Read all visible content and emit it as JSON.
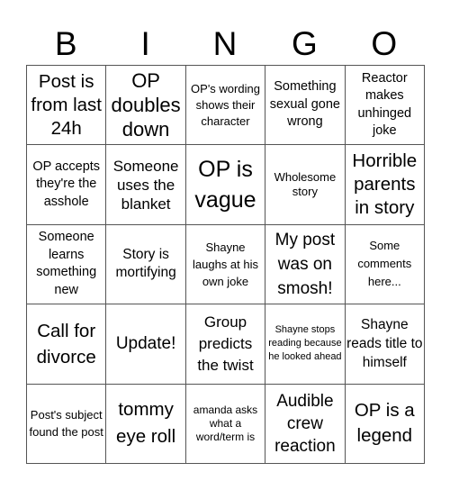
{
  "title_letters": [
    "B",
    "I",
    "N",
    "G",
    "O"
  ],
  "cells": [
    "Post is from last 24h",
    "OP doubles down",
    "OP's wording shows their character",
    "Something sexual gone wrong",
    "Reactor makes unhinged joke",
    "OP accepts they're the asshole",
    "Someone uses the blanket",
    "OP is vague",
    "Wholesome story",
    "Horrible parents in story",
    "Someone learns something new",
    "Story is mortifying",
    "Shayne laughs at his own joke",
    "My post was on smosh!",
    "Some comments here...",
    "Call for divorce",
    "Update!",
    "Group predicts the twist",
    "Shayne stops reading because he looked ahead",
    "Shayne reads title to himself",
    "Post's subject found the post",
    "tommy eye roll",
    "amanda asks what a word/term is",
    "Audible crew reaction",
    "OP is a legend"
  ]
}
